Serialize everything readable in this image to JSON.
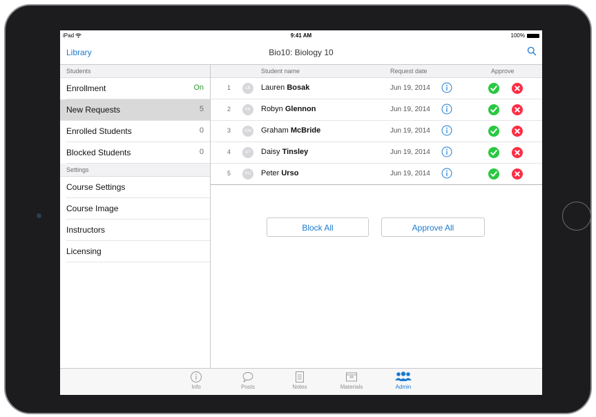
{
  "status": {
    "left": "iPad",
    "time": "9:41 AM",
    "battery": "100%"
  },
  "nav": {
    "back_label": "Library",
    "title": "Bio10: Biology 10"
  },
  "sidebar": {
    "students_header": "Students",
    "students": [
      {
        "label": "Enrollment",
        "value": "On"
      },
      {
        "label": "New Requests",
        "value": "5"
      },
      {
        "label": "Enrolled Students",
        "value": "0"
      },
      {
        "label": "Blocked Students",
        "value": "0"
      }
    ],
    "settings_header": "Settings",
    "settings": [
      {
        "label": "Course Settings"
      },
      {
        "label": "Course Image"
      },
      {
        "label": "Instructors"
      },
      {
        "label": "Licensing"
      }
    ]
  },
  "table": {
    "col_name": "Student name",
    "col_date": "Request date",
    "col_approve": "Approve",
    "rows": [
      {
        "num": "1",
        "initials": "LB",
        "first": "Lauren",
        "last": "Bosak",
        "date": "Jun 19, 2014"
      },
      {
        "num": "2",
        "initials": "KK",
        "first": "Robyn",
        "last": "Glennon",
        "date": "Jun 19, 2014"
      },
      {
        "num": "3",
        "initials": "GM",
        "first": "Graham",
        "last": "McBride",
        "date": "Jun 19, 2014"
      },
      {
        "num": "4",
        "initials": "DT",
        "first": "Daisy",
        "last": "Tinsley",
        "date": "Jun 19, 2014"
      },
      {
        "num": "5",
        "initials": "PU",
        "first": "Peter",
        "last": "Urso",
        "date": "Jun 19, 2014"
      }
    ]
  },
  "actions": {
    "block_all": "Block All",
    "approve_all": "Approve All"
  },
  "tabs": [
    {
      "label": "Info",
      "icon": "info-icon"
    },
    {
      "label": "Posts",
      "icon": "speech-bubble-icon"
    },
    {
      "label": "Notes",
      "icon": "document-icon"
    },
    {
      "label": "Materials",
      "icon": "box-icon"
    },
    {
      "label": "Admin",
      "icon": "people-icon",
      "active": true
    }
  ],
  "colors": {
    "accent": "#1a7ad0",
    "approve": "#27c93f",
    "reject": "#ff2d44",
    "on": "#2e9a2e"
  }
}
